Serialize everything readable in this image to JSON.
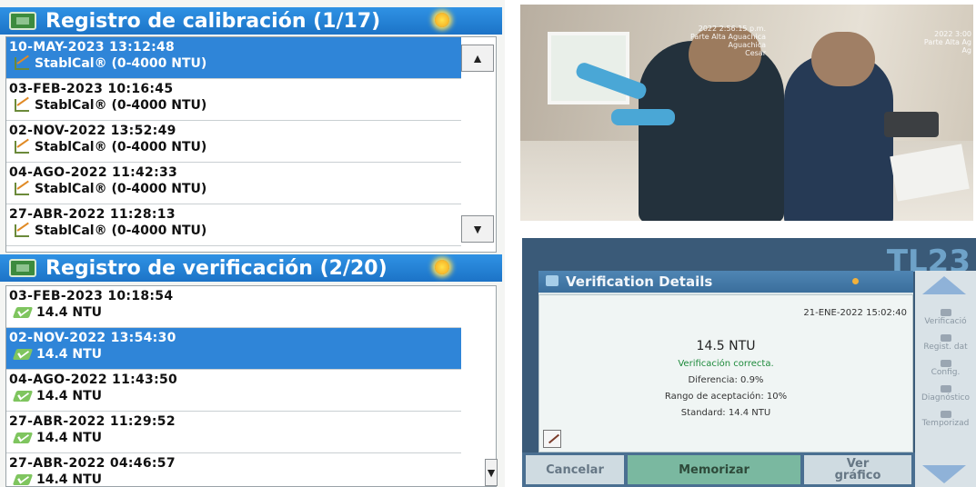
{
  "calibration": {
    "title": "Registro de calibración (1/17)",
    "rows": [
      {
        "date": "10-MAY-2023  13:12:48",
        "label": "StablCal® (0-4000 NTU)",
        "selected": true
      },
      {
        "date": "03-FEB-2023  10:16:45",
        "label": "StablCal® (0-4000 NTU)",
        "selected": false
      },
      {
        "date": "02-NOV-2022  13:52:49",
        "label": "StablCal® (0-4000 NTU)",
        "selected": false
      },
      {
        "date": "04-AGO-2022  11:42:33",
        "label": "StablCal® (0-4000 NTU)",
        "selected": false
      },
      {
        "date": "27-ABR-2022  11:28:13",
        "label": "StablCal® (0-4000 NTU)",
        "selected": false
      }
    ]
  },
  "verification": {
    "title": "Registro de verificación (2/20)",
    "rows": [
      {
        "date": "03-FEB-2023  10:18:54",
        "label": "14.4  NTU",
        "selected": false
      },
      {
        "date": "02-NOV-2022  13:54:30",
        "label": "14.4  NTU",
        "selected": true
      },
      {
        "date": "04-AGO-2022  11:43:50",
        "label": "14.4  NTU",
        "selected": false
      },
      {
        "date": "27-ABR-2022  11:29:52",
        "label": "14.4  NTU",
        "selected": false
      },
      {
        "date": "27-ABR-2022  04:46:57",
        "label": "14.4  NTU",
        "selected": false
      }
    ]
  },
  "scroll": {
    "up": "▲",
    "down": "▼"
  },
  "photo": {
    "stamp_left": "2022 2:56:15 p.m.\nParte Alta Aguachica\nAguachica\nCesar",
    "stamp_right": "2022 3:00\nParte Alta Ag\nAg"
  },
  "device": {
    "brand": "TL23",
    "window_title": "Verification Details",
    "timestamp": "21-ENE-2022 15:02:40",
    "result": "14.5 NTU",
    "status": "Verificación correcta.",
    "difference": "Diferencia:   0.9%",
    "acceptance": "Rango de aceptación: 10%",
    "standard": "Standard: 14.4 NTU",
    "side_items": [
      "Verificació",
      "Regist. dat",
      "Config.",
      "Diagnóstico",
      "Temporizad"
    ],
    "buttons": {
      "cancel": "Cancelar",
      "store": "Memorizar",
      "graph_line1": "Ver",
      "graph_line2": "gráfico"
    }
  }
}
